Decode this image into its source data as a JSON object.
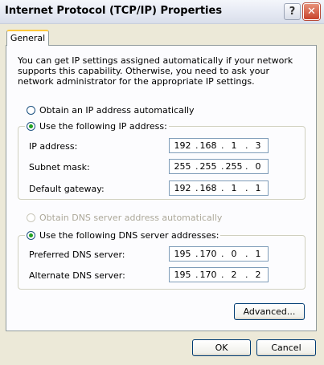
{
  "window": {
    "title": "Internet Protocol (TCP/IP) Properties",
    "help_glyph": "?",
    "close_glyph": "✕"
  },
  "tabs": {
    "general": "General"
  },
  "intro_text": "You can get IP settings assigned automatically if your network supports this capability. Otherwise, you need to ask your network administrator for the appropriate IP settings.",
  "ip_section": {
    "auto_label": "Obtain an IP address automatically",
    "manual_label": "Use the following IP address:",
    "fields": [
      {
        "label": "IP address:",
        "octets": [
          "192",
          "168",
          "1",
          "3"
        ]
      },
      {
        "label": "Subnet mask:",
        "octets": [
          "255",
          "255",
          "255",
          "0"
        ]
      },
      {
        "label": "Default gateway:",
        "octets": [
          "192",
          "168",
          "1",
          "1"
        ]
      }
    ]
  },
  "dns_section": {
    "auto_label": "Obtain DNS server address automatically",
    "manual_label": "Use the following DNS server addresses:",
    "fields": [
      {
        "label": "Preferred DNS server:",
        "octets": [
          "195",
          "170",
          "0",
          "1"
        ]
      },
      {
        "label": "Alternate DNS server:",
        "octets": [
          "195",
          "170",
          "2",
          "2"
        ]
      }
    ]
  },
  "buttons": {
    "advanced": "Advanced...",
    "ok": "OK",
    "cancel": "Cancel"
  },
  "colors": {
    "dialog_bg": "#ece9d8",
    "panel_bg": "#fcfcfe",
    "tab_accent": "#ffc83c",
    "radio_dot": "#21a121",
    "close_red": "#c8432b"
  },
  "icons": {
    "help": "question-mark-icon",
    "close": "close-x-icon"
  }
}
